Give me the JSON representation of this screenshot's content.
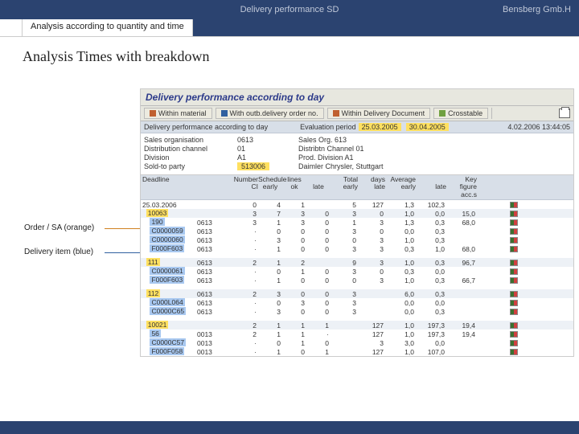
{
  "header": {
    "title": "Delivery performance SD",
    "right": "Bensberg Gmb.H"
  },
  "tab": {
    "label": "Analysis according to quantity and time"
  },
  "heading": "Analysis Times with breakdown",
  "legend": {
    "orange": "Order / SA (orange)",
    "blue": "Delivery item (blue)"
  },
  "screenshot": {
    "title": "Delivery performance according to day",
    "toolbar": {
      "b1": "Within material",
      "b2": "With outb.delivery order no.",
      "b3": "Within Delivery Document",
      "b4": "Crosstable"
    },
    "subhead": {
      "text": "Delivery performance according to day",
      "period_label": "Evaluation period",
      "d1": "25.03.2005",
      "d2": "30.04.2005",
      "right": "4.02.2006 13:44:05"
    },
    "info": {
      "r1a": "Sales organisation",
      "r1b": "0613",
      "r1c": "Sales Org. 613",
      "r2a": "Distribution channel",
      "r2b": "01",
      "r2c": "Distribtn Channel 01",
      "r3a": "Division",
      "r3b": "A1",
      "r3c": "Prod. Division A1",
      "r4a": "Sold-to party",
      "r4b": "513006",
      "r4c": "Daimler Chrysler, Stuttgart"
    },
    "headers": {
      "c1": "Deadline",
      "c2": "",
      "c3": "Number\nCI",
      "c4a": "Schedule",
      "c4b": "early",
      "c4c": "lines",
      "c4o": "ok",
      "c4l": "late",
      "c5a": "Total",
      "c5b": "early",
      "c5c": "days",
      "c5l": "late",
      "c6a": "Average",
      "c6b": "early",
      "c6l": "late",
      "c7": "Key figure\nacc.s"
    },
    "groups": [
      {
        "date": "25.03.2006",
        "dateTotals": [
          "0",
          "4",
          "1",
          "",
          "5",
          "127",
          "1,3",
          "102,3",
          ""
        ],
        "orange": "10063",
        "orangeRow": [
          "3",
          "7",
          "3",
          "0",
          "3",
          "0",
          "1,0",
          "0,0",
          "15,0"
        ],
        "blues": [
          {
            "id": "190",
            "co": "0613",
            "vals": [
              "3",
              "1",
              "3",
              "0",
              "1",
              "3",
              "1,3",
              "0,3",
              "68,0"
            ]
          },
          {
            "id": "C0000059",
            "co": "0613",
            "vals": [
              "·",
              "0",
              "0",
              "0",
              "3",
              "0",
              "0,0",
              "0,3",
              ""
            ]
          },
          {
            "id": "C0000060",
            "co": "0613",
            "vals": [
              "·",
              "3",
              "0",
              "0",
              "0",
              "3",
              "1,0",
              "0,3",
              ""
            ]
          },
          {
            "id": "F000F603",
            "co": "0613",
            "vals": [
              "·",
              "1",
              "0",
              "0",
              "3",
              "3",
              "0,3",
              "1,0",
              "68,0"
            ]
          }
        ]
      },
      {
        "orange": "111",
        "orangeCo": "0613",
        "orangeRow": [
          "2",
          "1",
          "2",
          "",
          "9",
          "3",
          "1,0",
          "0,3",
          "96,7"
        ],
        "blues": [
          {
            "id": "C0000061",
            "co": "0613",
            "vals": [
              "·",
              "0",
              "1",
              "0",
              "3",
              "0",
              "0,3",
              "0,0",
              ""
            ]
          },
          {
            "id": "F000F603",
            "co": "0613",
            "vals": [
              "·",
              "1",
              "0",
              "0",
              "0",
              "3",
              "1,0",
              "0,3",
              "66,7"
            ]
          }
        ]
      },
      {
        "orange": "112",
        "orangeCo": "0613",
        "orangeRow": [
          "2",
          "3",
          "0",
          "0",
          "3",
          "",
          "6,0",
          "0,3",
          ""
        ],
        "blues": [
          {
            "id": "C000L064",
            "co": "0613",
            "vals": [
              "·",
              "0",
              "3",
              "0",
              "3",
              "",
              "0,0",
              "0,0",
              ""
            ]
          },
          {
            "id": "C0000C65",
            "co": "0613",
            "vals": [
              "·",
              "3",
              "0",
              "0",
              "3",
              "",
              "0,0",
              "0,3",
              ""
            ]
          }
        ]
      },
      {
        "orange": "10021",
        "orangeRow": [
          "2",
          "1",
          "1",
          "1",
          "",
          "127",
          "1,0",
          "197,3",
          "19,4"
        ],
        "blues": [
          {
            "id": "56",
            "co": "0013",
            "vals": [
              "2",
              "1",
              "1",
              "·",
              "",
              "127",
              "1,0",
              "197,3",
              "19,4"
            ]
          },
          {
            "id": "C0000C57",
            "co": "0013",
            "vals": [
              "·",
              "0",
              "1",
              "0",
              "",
              "3",
              "3,0",
              "0,0",
              ""
            ]
          },
          {
            "id": "F000F058",
            "co": "0013",
            "vals": [
              "·",
              "1",
              "0",
              "1",
              "",
              "127",
              "1,0",
              "107,0",
              ""
            ]
          }
        ]
      }
    ]
  }
}
